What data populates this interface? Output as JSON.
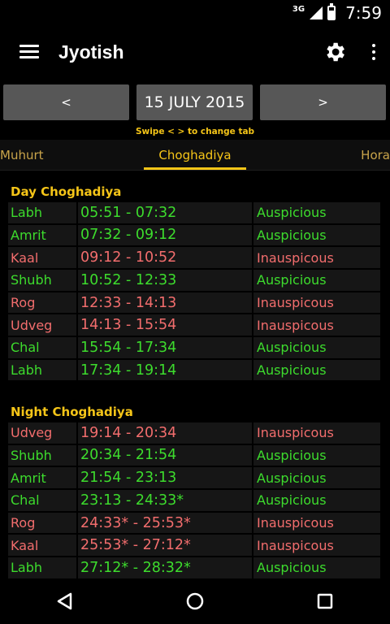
{
  "status": {
    "network": "3G",
    "time": "7:59"
  },
  "app": {
    "title": "Jyotish",
    "settings_icon": "gear-icon",
    "menu_icon": "hamburger-icon",
    "overflow_icon": "more-vert-icon"
  },
  "date_nav": {
    "prev_label": "<",
    "date": "15 JULY 2015",
    "next_label": ">",
    "hint": "Swipe < > to change tab"
  },
  "tabs": {
    "left": "Muhurt",
    "active": "Choghadiya",
    "right": "Hora"
  },
  "colors": {
    "accent": "#f5c518",
    "auspicious": "#3ddc2d",
    "inauspicious": "#f26d6d"
  },
  "day": {
    "title": "Day Choghadiya",
    "rows": [
      {
        "name": "Labh",
        "time": "05:51 - 07:32",
        "type": "Auspicious",
        "good": true
      },
      {
        "name": "Amrit",
        "time": "07:32 - 09:12",
        "type": "Auspicious",
        "good": true
      },
      {
        "name": "Kaal",
        "time": "09:12 - 10:52",
        "type": "Inauspicous",
        "good": false
      },
      {
        "name": "Shubh",
        "time": "10:52 - 12:33",
        "type": "Auspicious",
        "good": true
      },
      {
        "name": "Rog",
        "time": "12:33 - 14:13",
        "type": "Inauspicous",
        "good": false
      },
      {
        "name": "Udveg",
        "time": "14:13 - 15:54",
        "type": "Inauspicous",
        "good": false
      },
      {
        "name": "Chal",
        "time": "15:54 - 17:34",
        "type": "Auspicious",
        "good": true
      },
      {
        "name": "Labh",
        "time": "17:34 - 19:14",
        "type": "Auspicious",
        "good": true
      }
    ]
  },
  "night": {
    "title": "Night Choghadiya",
    "rows": [
      {
        "name": "Udveg",
        "time": "19:14 - 20:34",
        "type": "Inauspicous",
        "good": false
      },
      {
        "name": "Shubh",
        "time": "20:34 - 21:54",
        "type": "Auspicious",
        "good": true
      },
      {
        "name": "Amrit",
        "time": "21:54 - 23:13",
        "type": "Auspicious",
        "good": true
      },
      {
        "name": "Chal",
        "time": "23:13 - 24:33*",
        "type": "Auspicious",
        "good": true
      },
      {
        "name": "Rog",
        "time": "24:33* - 25:53*",
        "type": "Inauspicous",
        "good": false
      },
      {
        "name": "Kaal",
        "time": "25:53* - 27:12*",
        "type": "Inauspicous",
        "good": false
      },
      {
        "name": "Labh",
        "time": "27:12* - 28:32*",
        "type": "Auspicious",
        "good": true
      }
    ]
  },
  "navbar": {
    "back_icon": "back-triangle-icon",
    "home_icon": "home-circle-icon",
    "recents_icon": "recents-square-icon"
  }
}
